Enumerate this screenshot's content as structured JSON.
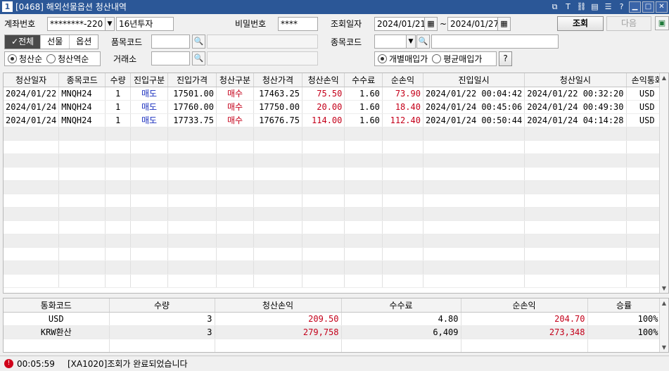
{
  "window": {
    "title": "[0468] 해외선물옵션 청산내역",
    "app_icon": "1",
    "icons": [
      "popout-icon",
      "text-icon",
      "link-icon",
      "print-icon",
      "list-icon",
      "help-icon",
      "minimize-icon",
      "maximize-icon",
      "close-icon"
    ],
    "icon_glyphs": [
      "⧉",
      "T",
      "⛓",
      "▤",
      "☰",
      "?",
      "▁",
      "□",
      "✕"
    ]
  },
  "query": {
    "account_label": "계좌번호",
    "account_value": "********-220",
    "account_name": "16년투자",
    "password_label": "비밀번호",
    "password_value": "****",
    "date_label": "조회일자",
    "date_from": "2024/01/21",
    "date_sep": "~",
    "date_to": "2024/01/27",
    "search_button": "조회",
    "next_button": "다음",
    "type_tabs": [
      "전체",
      "선물",
      "옵션"
    ],
    "item_code_label": "품목코드",
    "symbol_code_label": "종목코드",
    "exchange_label": "거래소",
    "sort_options": [
      "청산순",
      "청산역순"
    ],
    "buy_options": [
      "개별매입가",
      "평균매입가"
    ],
    "help_button": "?"
  },
  "detail_table": {
    "columns": [
      "청산일자",
      "종목코드",
      "수량",
      "진입구분",
      "진입가격",
      "청산구분",
      "청산가격",
      "청산손익",
      "수수료",
      "순손익",
      "진입일시",
      "청산일시",
      "손익통화"
    ],
    "rows": [
      [
        "2024/01/22",
        "MNQH24",
        "1",
        "매도",
        "17501.00",
        "매수",
        "17463.25",
        "75.50",
        "1.60",
        "73.90",
        "2024/01/22 00:04:42",
        "2024/01/22 00:32:20",
        "USD"
      ],
      [
        "2024/01/24",
        "MNQH24",
        "1",
        "매도",
        "17760.00",
        "매수",
        "17750.00",
        "20.00",
        "1.60",
        "18.40",
        "2024/01/24 00:45:06",
        "2024/01/24 00:49:30",
        "USD"
      ],
      [
        "2024/01/24",
        "MNQH24",
        "1",
        "매도",
        "17733.75",
        "매수",
        "17676.75",
        "114.00",
        "1.60",
        "112.40",
        "2024/01/24 00:50:44",
        "2024/01/24 04:14:28",
        "USD"
      ]
    ]
  },
  "summary_table": {
    "columns": [
      "통화코드",
      "수량",
      "청산손익",
      "수수료",
      "순손익",
      "승률"
    ],
    "rows": [
      [
        "USD",
        "3",
        "209.50",
        "4.80",
        "204.70",
        "100%"
      ],
      [
        "KRW환산",
        "3",
        "279,758",
        "6,409",
        "273,348",
        "100%"
      ]
    ]
  },
  "status": {
    "time": "00:05:59",
    "message": "[XA1020]조회가 완료되었습니다"
  },
  "colors": {
    "title_bar": "#2b5797",
    "profit_red": "#c4001a",
    "sell_blue": "#1a2fbe"
  }
}
